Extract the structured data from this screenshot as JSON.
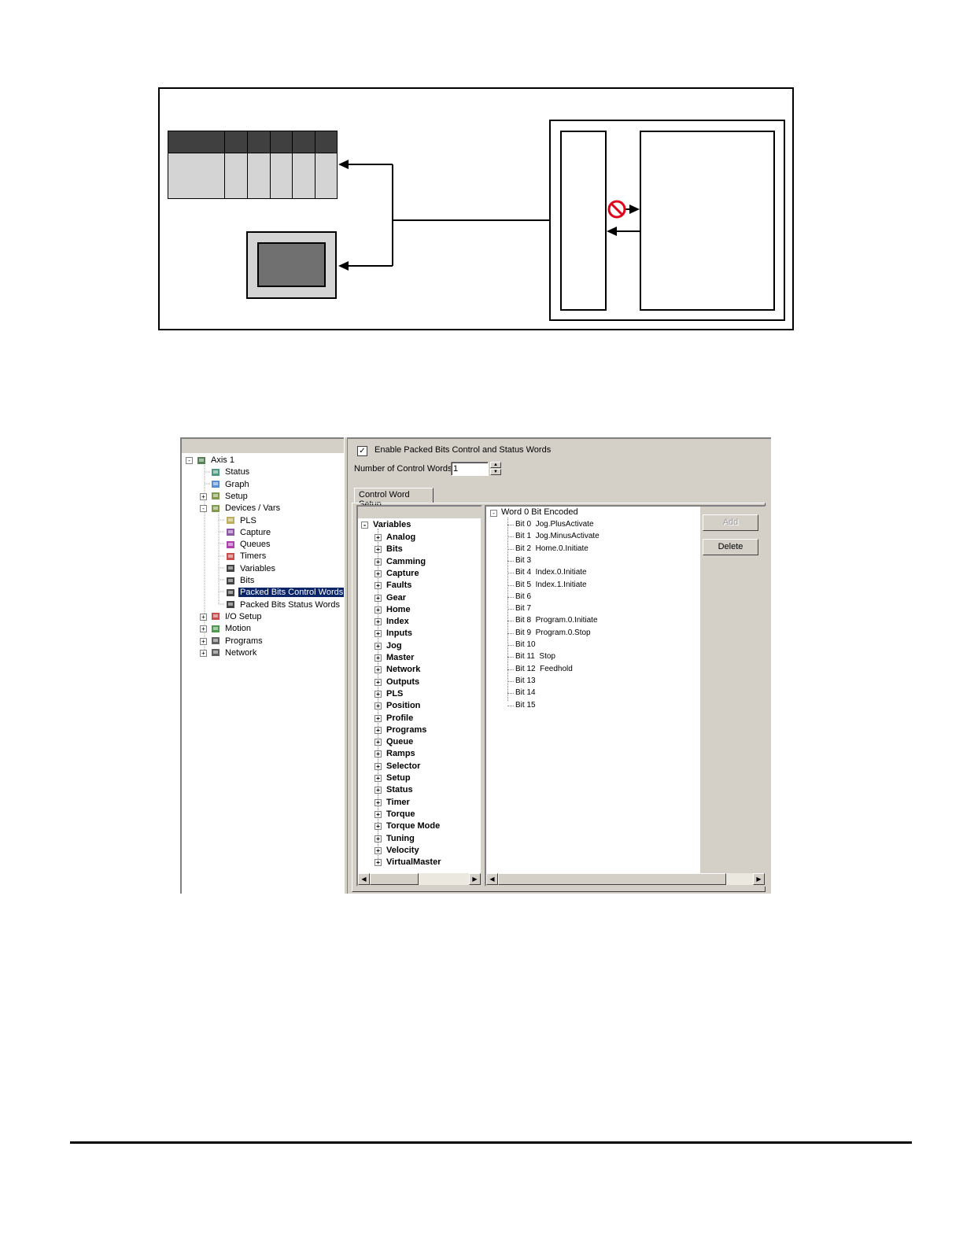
{
  "left_tree": {
    "items": [
      {
        "label": "Axis 1",
        "icon": "drive-icon",
        "expander": "-"
      },
      {
        "label": "Status",
        "icon": "monitor-icon",
        "expander": ""
      },
      {
        "label": "Graph",
        "icon": "graph-icon",
        "expander": ""
      },
      {
        "label": "Setup",
        "icon": "setup-icon",
        "expander": "+"
      },
      {
        "label": "Devices / Vars",
        "icon": "devices-icon",
        "expander": "-"
      },
      {
        "label": "PLS",
        "icon": "pls-icon",
        "expander": ""
      },
      {
        "label": "Capture",
        "icon": "capture-icon",
        "expander": ""
      },
      {
        "label": "Queues",
        "icon": "queues-icon",
        "expander": ""
      },
      {
        "label": "Timers",
        "icon": "timer-icon",
        "expander": ""
      },
      {
        "label": "Variables",
        "icon": "user-variables-icon",
        "expander": ""
      },
      {
        "label": "Bits",
        "icon": "user-bits-icon",
        "expander": ""
      },
      {
        "label": "Packed Bits Control Words",
        "icon": "user-bits-icon",
        "expander": ""
      },
      {
        "label": "Packed Bits Status Words",
        "icon": "user-bits-icon",
        "expander": ""
      },
      {
        "label": "I/O Setup",
        "icon": "io-icon",
        "expander": "+"
      },
      {
        "label": "Motion",
        "icon": "motion-icon",
        "expander": "+"
      },
      {
        "label": "Programs",
        "icon": "programs-icon",
        "expander": "+"
      },
      {
        "label": "Network",
        "icon": "network-icon",
        "expander": "+"
      }
    ]
  },
  "settings": {
    "enable_label": "Enable Packed Bits Control and Status Words",
    "enable_checked": "✓",
    "num_control_words_label": "Number of Control Words",
    "num_control_words_value": "1"
  },
  "tab": {
    "label": "Control Word Setup"
  },
  "variables_tree": {
    "root": "Variables",
    "items": [
      "Analog",
      "Bits",
      "Camming",
      "Capture",
      "Faults",
      "Gear",
      "Home",
      "Index",
      "Inputs",
      "Jog",
      "Master",
      "Network",
      "Outputs",
      "PLS",
      "Position",
      "Profile",
      "Programs",
      "Queue",
      "Ramps",
      "Selector",
      "Setup",
      "Status",
      "Timer",
      "Torque",
      "Torque Mode",
      "Tuning",
      "Velocity",
      "VirtualMaster"
    ]
  },
  "word_tree": {
    "root": "Word 0  Bit Encoded",
    "bits": [
      {
        "bit": "Bit 0",
        "assignment": "Jog.PlusActivate"
      },
      {
        "bit": "Bit 1",
        "assignment": "Jog.MinusActivate"
      },
      {
        "bit": "Bit 2",
        "assignment": "Home.0.Initiate"
      },
      {
        "bit": "Bit 3",
        "assignment": ""
      },
      {
        "bit": "Bit 4",
        "assignment": "Index.0.Initiate"
      },
      {
        "bit": "Bit 5",
        "assignment": "Index.1.Initiate"
      },
      {
        "bit": "Bit 6",
        "assignment": ""
      },
      {
        "bit": "Bit 7",
        "assignment": ""
      },
      {
        "bit": "Bit 8",
        "assignment": "Program.0.Initiate"
      },
      {
        "bit": "Bit 9",
        "assignment": "Program.0.Stop"
      },
      {
        "bit": "Bit 10",
        "assignment": ""
      },
      {
        "bit": "Bit 11",
        "assignment": "Stop"
      },
      {
        "bit": "Bit 12",
        "assignment": "Feedhold"
      },
      {
        "bit": "Bit 13",
        "assignment": ""
      },
      {
        "bit": "Bit 14",
        "assignment": ""
      },
      {
        "bit": "Bit 15",
        "assignment": ""
      }
    ]
  },
  "buttons": {
    "add_label": "Add",
    "delete_label": "Delete"
  },
  "colors": {
    "selection": "#0a246a",
    "panel": "#d4d0c8",
    "plc_header": "#404040",
    "hmi_screen": "#707070",
    "no_symbol": "#e0001a"
  }
}
